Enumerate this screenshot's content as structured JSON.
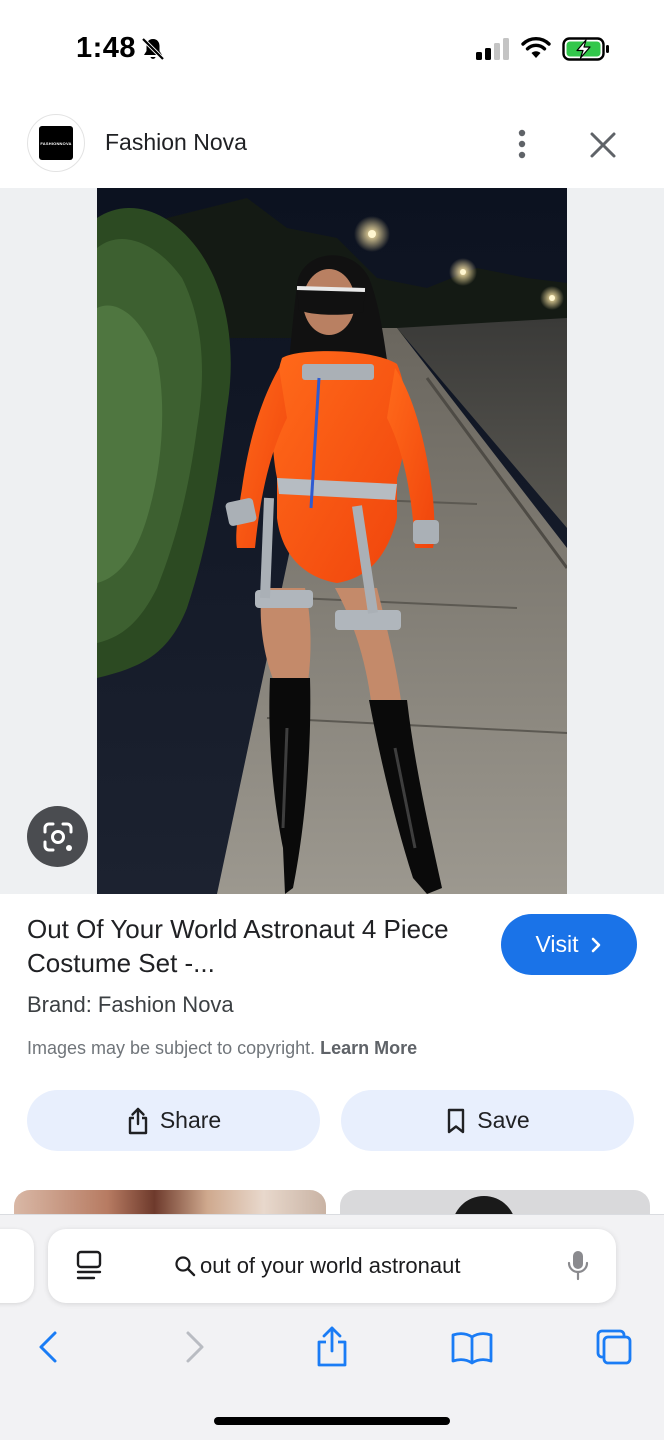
{
  "status_bar": {
    "time": "1:48",
    "icons": [
      "bell-slash-icon",
      "cellular-signal-icon",
      "wifi-icon",
      "battery-charging-icon"
    ],
    "battery_color": "#32c74b"
  },
  "source": {
    "logo_text": "FASHIONNOVA",
    "name": "Fashion Nova"
  },
  "result": {
    "title": "Out Of Your World Astronaut 4 Piece Costume Set -...",
    "visit_label": "Visit",
    "brand": "Brand: Fashion Nova",
    "copyright_text": "Images may be subject to copyright.",
    "learn_more_label": "Learn More",
    "share_label": "Share",
    "save_label": "Save"
  },
  "browser": {
    "query": "out of your world astronaut"
  },
  "colors": {
    "accent": "#1a73e8",
    "action_button_bg": "#e8effd",
    "safari_blue": "#1a7cf5"
  }
}
